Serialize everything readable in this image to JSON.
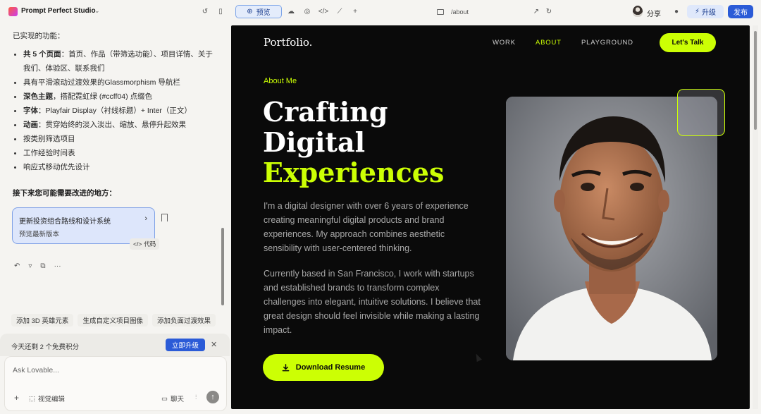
{
  "topbar": {
    "app_title": "Prompt Perfect Studio",
    "preview_label": "预览",
    "url_path": "/about",
    "share_label": "分享",
    "upgrade_label": "升级",
    "publish_label": "发布"
  },
  "chat": {
    "implemented_heading": "已实现的功能：",
    "features": [
      {
        "bold": "共 5 个页面",
        "rest": "：首页、作品（带筛选功能）、项目详情、关于我们、体验区、联系我们"
      },
      {
        "bold": "",
        "rest": "具有平滑滚动过渡效果的Glassmorphism 导航栏"
      },
      {
        "bold": "深色主题",
        "rest": "，搭配霓虹绿 (#ccff04) 点缀色"
      },
      {
        "bold": "字体",
        "rest": "：Playfair Display（衬线标题）+ Inter（正文）"
      },
      {
        "bold": "动画",
        "rest": "：贯穿始终的淡入淡出、缩放、悬停升起效果"
      },
      {
        "bold": "",
        "rest": "按类别筛选项目"
      },
      {
        "bold": "",
        "rest": "工作经验时间表"
      },
      {
        "bold": "",
        "rest": "响应式移动优先设计"
      }
    ],
    "next_heading": "接下来您可能需要改进的地方：",
    "version_card": {
      "title": "更新投资组合路线和设计系统",
      "subtitle": "预览最新版本"
    },
    "code_chip": "代码",
    "suggestions": [
      "添加 3D 英雄元素",
      "生成自定义项目图像",
      "添加负面过渡效果"
    ],
    "credit_text": "今天还剩 2 个免费积分",
    "credit_button": "立即升级",
    "composer_placeholder": "Ask Lovable...",
    "visual_edit_label": "视觉编辑",
    "chat_label": "聊天"
  },
  "site": {
    "brand": "Portfolio.",
    "nav": [
      "WORK",
      "ABOUT",
      "PLAYGROUND"
    ],
    "cta": "Let's Talk",
    "kicker": "About Me",
    "title_line1": "Crafting",
    "title_line2": "Digital",
    "title_line3": "Experiences",
    "para1": "I'm a digital designer with over 6 years of experience creating meaningful digital products and brand experiences. My approach combines aesthetic sensibility with user-centered thinking.",
    "para2": "Currently based in San Francisco, I work with startups and established brands to transform complex challenges into elegant, intuitive solutions. I believe that great design should feel invisible while making a lasting impact.",
    "download_label": "Download Resume"
  },
  "colors": {
    "accent": "#ccff04",
    "site_bg": "#0a0a0a",
    "primary_blue": "#2b5bd7"
  },
  "icons": {
    "preview": "globe-icon",
    "download": "download-icon",
    "upgrade": "bolt-icon"
  }
}
